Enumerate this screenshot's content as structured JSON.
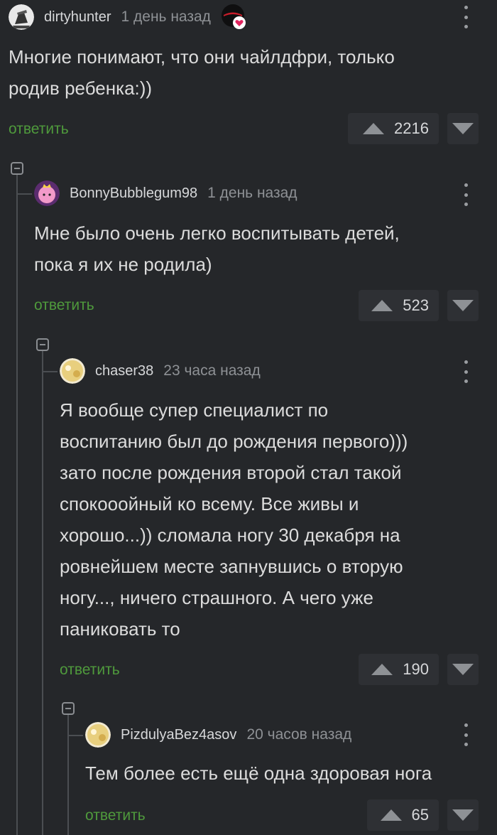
{
  "comments": [
    {
      "username": "dirtyhunter",
      "time": "1 день назад",
      "lines": [
        "Многие понимают, что они чайлдфри, только",
        "родив ребенка:))"
      ],
      "reply_label": "ответить",
      "score": "2216",
      "avatar_icon": "ninja-avatar-icon",
      "badge_icon": "heart-badge-icon"
    },
    {
      "username": "BonnyBubblegum98",
      "time": "1 день назад",
      "lines": [
        "Мне было очень легко воспитывать детей,",
        "пока я их не родила)"
      ],
      "reply_label": "ответить",
      "score": "523",
      "avatar_icon": "princess-avatar-icon"
    },
    {
      "username": "chaser38",
      "time": "23 часа назад",
      "lines": [
        "Я вообще супер специалист по",
        "воспитанию был до рождения первого)))",
        "зато после рождения второй стал такой",
        "спокооойный ко всему. Все живы и",
        "хорошо...)) сломала ногу 30 декабря на",
        "ровнейшем месте запнувшись о вторую",
        "ногу..., ничего страшного. А чего уже",
        "паниковать то"
      ],
      "reply_label": "ответить",
      "score": "190",
      "avatar_icon": "default-avatar-icon"
    },
    {
      "username": "PizdulyaBez4asov",
      "time": "20 часов назад",
      "lines": [
        "Тем более есть ещё одна здоровая нога"
      ],
      "reply_label": "ответить",
      "score": "65",
      "avatar_icon": "default-avatar-icon"
    }
  ],
  "colors": {
    "background": "#25272a",
    "reply": "#4f9a3c",
    "vote_bg": "#2e3034",
    "badge_heart": "#e0245e"
  }
}
